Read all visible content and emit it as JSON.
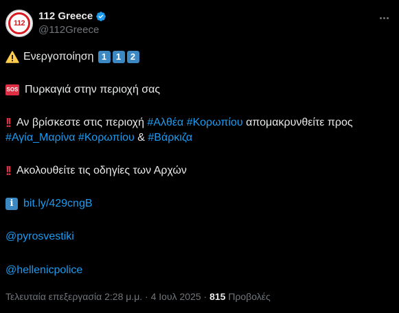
{
  "author": {
    "display_name": "112 Greece",
    "handle": "@112Greece",
    "avatar_text": "112"
  },
  "tweet": {
    "line1": {
      "text": "Ενεργοποίηση",
      "keycaps": [
        "1",
        "1",
        "2"
      ]
    },
    "line2": {
      "sos_label": "SOS",
      "text": "Πυρκαγιά στην περιοχή σας"
    },
    "line3": {
      "prefix": "Αν βρίσκεστε στις περιοχή",
      "tag1": "#Αλθέα",
      "tag2": "#Κορωπίου",
      "suffix": "απομακρυνθείτε προς"
    },
    "line4": {
      "tag1": "#Αγία_Μαρίνα",
      "tag2": "#Κορωπίου",
      "amp": "&",
      "tag3": "#Βάρκιζα"
    },
    "line5": {
      "text": "Ακολουθείτε τις οδηγίες των Αρχών"
    },
    "line6": {
      "info_label": "i",
      "link": "bit.ly/429cngB"
    },
    "mention1": "@pyrosvestiki",
    "mention2": "@hellenicpolice"
  },
  "meta": {
    "edited_time": "Τελευταία επεξεργασία 2:28 μ.μ. · 4 Ιουλ 2025 ·",
    "views_count": "815",
    "views_label": "Προβολές"
  },
  "colors": {
    "background": "#000000",
    "text": "#e7e9ea",
    "link": "#1d9bf0",
    "secondary": "#71767b",
    "verified": "#1d9bf0",
    "keycap": "#3b88c3",
    "alert_red": "#dd2e44"
  }
}
